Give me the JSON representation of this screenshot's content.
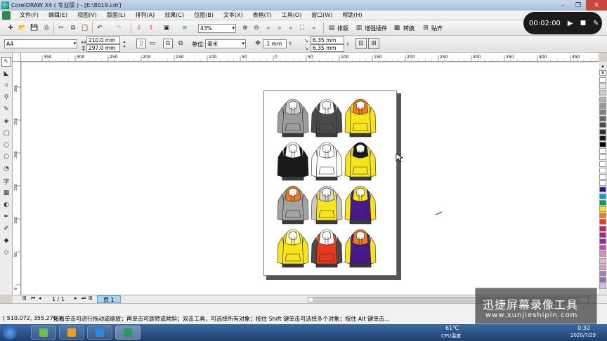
{
  "window": {
    "title": "CorelDRAW X4 ( 专业版 ) - [E:\\8019.cdr]",
    "min_symbol": "–",
    "max_symbol": "❐",
    "close_symbol": "✕"
  },
  "menu": {
    "items": [
      "文件(F)",
      "编辑(E)",
      "视图(V)",
      "版面(L)",
      "排列(A)",
      "效果(C)",
      "位图(B)",
      "文本(X)",
      "表格(T)",
      "工具(O)",
      "窗口(W)",
      "帮助(H)"
    ]
  },
  "standard_toolbar": {
    "zoom_value": "43%",
    "buttons": [
      {
        "label": "排版"
      },
      {
        "label": "增强插件"
      },
      {
        "label": "转换"
      },
      {
        "label": "贴齐"
      }
    ]
  },
  "property_bar": {
    "paper_size": "A4",
    "width": "210.0 mm",
    "height": "297.0 mm",
    "units_label": "单位:",
    "units_value": "毫米",
    "nudge": ".1 mm",
    "dup_x": "6.35 mm",
    "dup_y": "6.35 mm"
  },
  "ruler": {
    "h_ticks": [
      "350",
      "300",
      "250",
      "200",
      "150",
      "100",
      "50",
      "0",
      "50",
      "100",
      "150",
      "200",
      "250",
      "300",
      "350",
      "400",
      "450",
      "500"
    ],
    "v_ticks": [
      "300",
      "250",
      "200",
      "150",
      "100",
      "50",
      "0"
    ]
  },
  "document": {
    "hoodies": [
      {
        "body": "#9c9c9c",
        "accent": "#cfcfcf",
        "sleeve": "#9c9c9c"
      },
      {
        "body": "#4a4a4a",
        "accent": "#ffffff",
        "sleeve": "#4a4a4a"
      },
      {
        "body": "#f7e41a",
        "accent": "#ef7b1a",
        "sleeve": "#f7e41a"
      },
      {
        "body": "#1a1a1a",
        "accent": "#ffffff",
        "sleeve": "#1a1a1a"
      },
      {
        "body": "#ffffff",
        "accent": "#ffffff",
        "sleeve": "#ffffff"
      },
      {
        "body": "#f7e41a",
        "accent": "#1a1a1a",
        "sleeve": "#f7e41a"
      },
      {
        "body": "#a3a3a3",
        "accent": "#ef7b1a",
        "sleeve": "#a3a3a3"
      },
      {
        "body": "#f7e41a",
        "accent": "#d4d4d4",
        "sleeve": "#c8c8c8"
      },
      {
        "body": "#4a1a8a",
        "accent": "#f7e41a",
        "sleeve": "#f7e41a"
      },
      {
        "body": "#f7e41a",
        "accent": "#fff88a",
        "sleeve": "#f7e41a"
      },
      {
        "body": "#e8391c",
        "accent": "#ffffff",
        "sleeve": "#4a4a4a"
      },
      {
        "body": "#4a1a8a",
        "accent": "#ef7b1a",
        "sleeve": "#f7e41a"
      }
    ]
  },
  "palette": {
    "colors": [
      "#ffffff",
      "#e6e6e6",
      "#cccccc",
      "#b3b3b3",
      "#999999",
      "#808080",
      "#666666",
      "#4d4d4d",
      "#333333",
      "#1a1a1a",
      "#000000",
      "#ffffff",
      "#ffffff",
      "#ffffff",
      "#ffffff",
      "#ffffff",
      "#ffffff",
      "#1f1f8a",
      "#00a0e0",
      "#00a04a",
      "#f7e41a",
      "#ef7b1a",
      "#e8391c",
      "#c81e64",
      "#a0288c",
      "#8e2e8e",
      "#b25aa6",
      "#d091c0",
      "#e8b4d4",
      "#c8a0c8",
      "#a87ab6",
      "#9a6ab0",
      "#d4c0e0"
    ]
  },
  "page_nav": {
    "counter": "1 / 1",
    "page_tab": "页 1"
  },
  "status": {
    "coords": "( 510.072, 355.270 )",
    "hint": "接着单击可进行拖动或缩放；再单击可旋转或倾斜；双击工具，可选择所有对象；按住 Shift 键单击可选择多个对象；按住 Alt 键单击..."
  },
  "recorder": {
    "timer": "00:02:00",
    "play_symbol": "▶",
    "stop_symbol": "■",
    "edit_symbol": "✎"
  },
  "watermark": {
    "title": "迅捷屏幕录像工具",
    "url": "www.xunjieshipin.com"
  },
  "taskbar": {
    "temp": "61℃",
    "temp_label": "CPU温度",
    "time": "0:32",
    "date": "2020/7/29"
  }
}
